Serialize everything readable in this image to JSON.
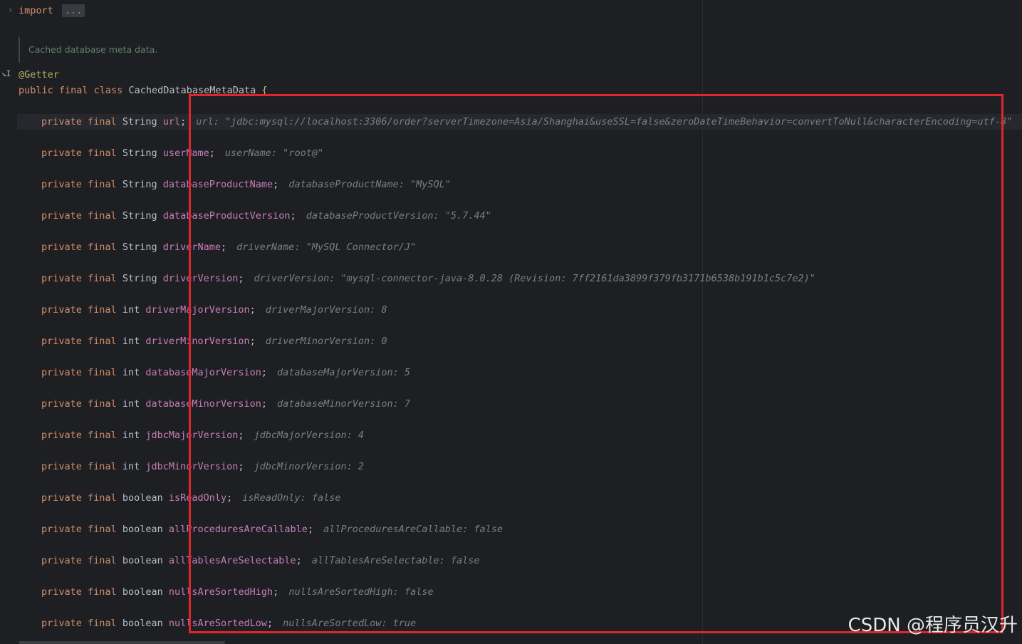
{
  "editor": {
    "import_keyword": "import",
    "import_fold": "...",
    "doc_comment": "Cached database meta data.",
    "annotation": "@Getter",
    "class_modifiers": "public final class",
    "class_name": "CachedDatabaseMetaData",
    "open_brace": "{"
  },
  "fields": [
    {
      "modifiers": "private final",
      "type": "String",
      "name": "url",
      "hint": "url: \"jdbc:mysql://localhost:3306/order?serverTimezone=Asia/Shanghai&useSSL=false&zeroDateTimeBehavior=convertToNull&characterEncoding=utf-8\""
    },
    {
      "modifiers": "private final",
      "type": "String",
      "name": "userName",
      "hint": "userName: \"root@\""
    },
    {
      "modifiers": "private final",
      "type": "String",
      "name": "databaseProductName",
      "hint": "databaseProductName: \"MySQL\""
    },
    {
      "modifiers": "private final",
      "type": "String",
      "name": "databaseProductVersion",
      "hint": "databaseProductVersion: \"5.7.44\""
    },
    {
      "modifiers": "private final",
      "type": "String",
      "name": "driverName",
      "hint": "driverName: \"MySQL Connector/J\""
    },
    {
      "modifiers": "private final",
      "type": "String",
      "name": "driverVersion",
      "hint": "driverVersion: \"mysql-connector-java-8.0.28 (Revision: 7ff2161da3899f379fb3171b6538b191b1c5c7e2)\""
    },
    {
      "modifiers": "private final",
      "type": "int",
      "name": "driverMajorVersion",
      "hint": "driverMajorVersion: 8"
    },
    {
      "modifiers": "private final",
      "type": "int",
      "name": "driverMinorVersion",
      "hint": "driverMinorVersion: 0"
    },
    {
      "modifiers": "private final",
      "type": "int",
      "name": "databaseMajorVersion",
      "hint": "databaseMajorVersion: 5"
    },
    {
      "modifiers": "private final",
      "type": "int",
      "name": "databaseMinorVersion",
      "hint": "databaseMinorVersion: 7"
    },
    {
      "modifiers": "private final",
      "type": "int",
      "name": "jdbcMajorVersion",
      "hint": "jdbcMajorVersion: 4"
    },
    {
      "modifiers": "private final",
      "type": "int",
      "name": "jdbcMinorVersion",
      "hint": "jdbcMinorVersion: 2"
    },
    {
      "modifiers": "private final",
      "type": "boolean",
      "name": "isReadOnly",
      "hint": "isReadOnly: false"
    },
    {
      "modifiers": "private final",
      "type": "boolean",
      "name": "allProceduresAreCallable",
      "hint": "allProceduresAreCallable: false"
    },
    {
      "modifiers": "private final",
      "type": "boolean",
      "name": "allTablesAreSelectable",
      "hint": "allTablesAreSelectable: false"
    },
    {
      "modifiers": "private final",
      "type": "boolean",
      "name": "nullsAreSortedHigh",
      "hint": "nullsAreSortedHigh: false"
    },
    {
      "modifiers": "private final",
      "type": "boolean",
      "name": "nullsAreSortedLow",
      "hint": "nullsAreSortedLow: true"
    }
  ],
  "semicolon": ";",
  "watermark": "CSDN @程序员汉升",
  "colors": {
    "keyword": "#cf8e6d",
    "field_name": "#c77dbb",
    "annotation": "#b3ae60",
    "inlay_hint": "#7a7e85",
    "highlight_box": "#e0262a",
    "background": "#1e1f22"
  }
}
